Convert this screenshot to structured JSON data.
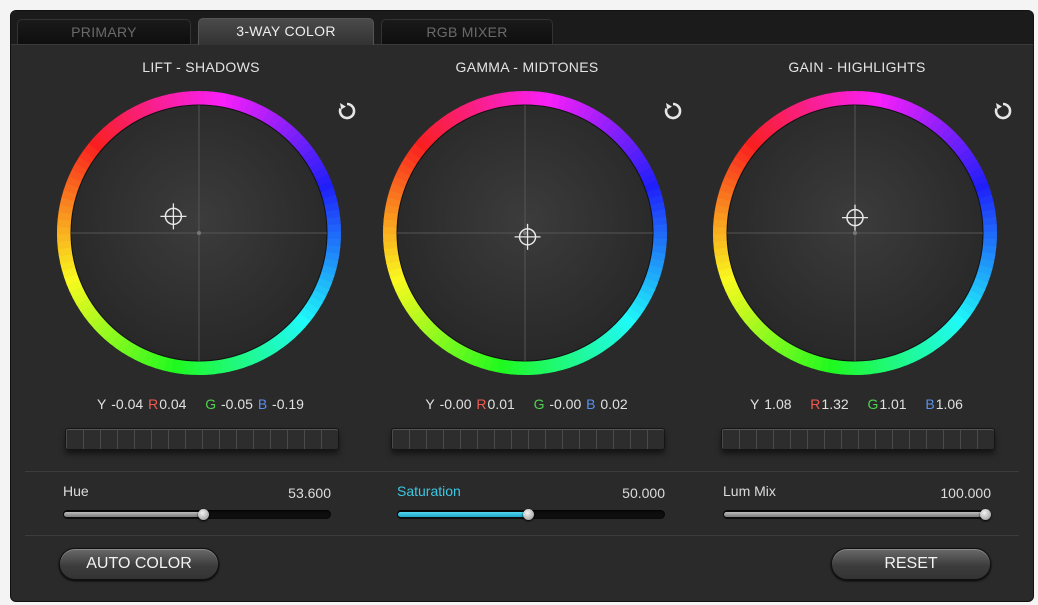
{
  "tabs": [
    {
      "label": "PRIMARY",
      "active": false
    },
    {
      "label": "3-WAY COLOR",
      "active": true
    },
    {
      "label": "RGB MIXER",
      "active": false
    }
  ],
  "wheels": [
    {
      "title": "LIFT - SHADOWS",
      "reset_icon": "rotate-ccw-icon",
      "y_label": "Y",
      "y": "-0.04",
      "r_label": "R",
      "r": "0.04",
      "g_label": "G",
      "g": "-0.05",
      "b_label": "B",
      "b": "-0.19",
      "puck": {
        "dx": -0.2,
        "dy": -0.13
      }
    },
    {
      "title": "GAMMA - MIDTONES",
      "reset_icon": "rotate-ccw-icon",
      "y_label": "Y",
      "y": "-0.00",
      "r_label": "R",
      "r": "0.01",
      "g_label": "G",
      "g": "-0.00",
      "b_label": "B",
      "b": "0.02",
      "puck": {
        "dx": 0.02,
        "dy": 0.03
      }
    },
    {
      "title": "GAIN - HIGHLIGHTS",
      "reset_icon": "rotate-ccw-icon",
      "y_label": "Y",
      "y": "1.08",
      "r_label": "R",
      "r": "1.32",
      "g_label": "G",
      "g": "1.01",
      "b_label": "B",
      "b": "1.06",
      "puck": {
        "dx": 0.0,
        "dy": -0.12
      }
    }
  ],
  "sliders": [
    {
      "label": "Hue",
      "value": "53.600",
      "fraction": 0.536,
      "accent": "gray"
    },
    {
      "label": "Saturation",
      "value": "50.000",
      "fraction": 0.5,
      "accent": "cyan"
    },
    {
      "label": "Lum Mix",
      "value": "100.000",
      "fraction": 1.0,
      "accent": "gray"
    }
  ],
  "buttons": {
    "auto_color": "AUTO COLOR",
    "reset": "RESET"
  },
  "colors": {
    "panel": "#2a2a2a",
    "accent_cyan": "#2fbfdc",
    "red_label": "#f05a4e",
    "green_label": "#4fd34f",
    "blue_label": "#5a8ff0"
  }
}
